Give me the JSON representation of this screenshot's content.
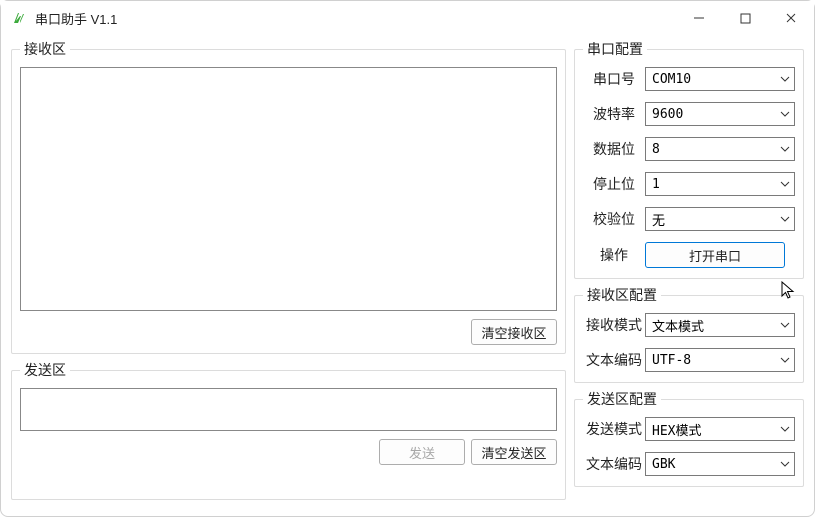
{
  "window": {
    "title": "串口助手 V1.1"
  },
  "receive": {
    "legend": "接收区",
    "clear_button": "清空接收区",
    "text": ""
  },
  "send": {
    "legend": "发送区",
    "send_button": "发送",
    "clear_button": "清空发送区",
    "text": ""
  },
  "serial_config": {
    "legend": "串口配置",
    "port_label": "串口号",
    "port_value": "COM10",
    "baud_label": "波特率",
    "baud_value": "9600",
    "databits_label": "数据位",
    "databits_value": "8",
    "stopbits_label": "停止位",
    "stopbits_value": "1",
    "parity_label": "校验位",
    "parity_value": "无",
    "action_label": "操作",
    "open_button": "打开串口"
  },
  "recv_config": {
    "legend": "接收区配置",
    "mode_label": "接收模式",
    "mode_value": "文本模式",
    "encoding_label": "文本编码",
    "encoding_value": "UTF-8"
  },
  "send_config": {
    "legend": "发送区配置",
    "mode_label": "发送模式",
    "mode_value": "HEX模式",
    "encoding_label": "文本编码",
    "encoding_value": "GBK"
  }
}
